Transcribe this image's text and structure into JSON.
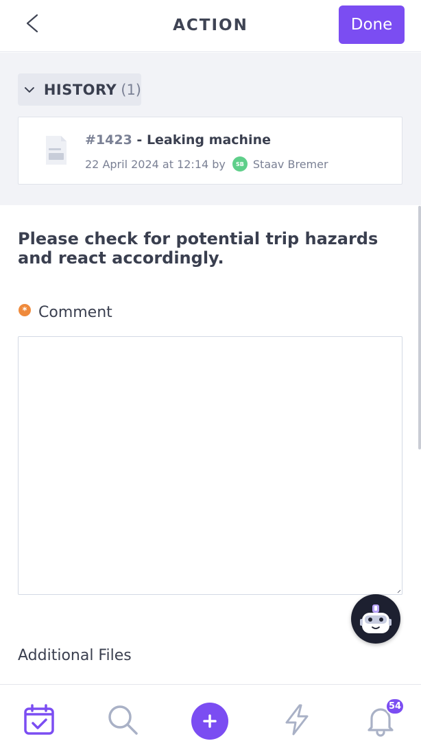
{
  "header": {
    "title": "ACTION",
    "done_label": "Done"
  },
  "history": {
    "title": "HISTORY",
    "count": "(1)",
    "items": [
      {
        "id": "#1423",
        "separator": " - ",
        "name": "Leaking machine",
        "meta": "22 April 2024 at 12:14 by",
        "avatar_initials": "SB",
        "author": "Staav Bremer"
      }
    ]
  },
  "instruction": "Please check for potential trip hazards and react accordingly.",
  "comment": {
    "label": "Comment",
    "required_mark": "*",
    "value": ""
  },
  "additional_files_label": "Additional Files",
  "bottom_nav": {
    "items": [
      "calendar-check-icon",
      "search-icon",
      "plus-icon",
      "lightning-icon",
      "bell-icon"
    ],
    "notification_count": "54"
  },
  "colors": {
    "accent": "#7b4df2",
    "required": "#ef8a3c",
    "avatar": "#5fcf8a",
    "inactive_icon": "#a9b1c6"
  }
}
